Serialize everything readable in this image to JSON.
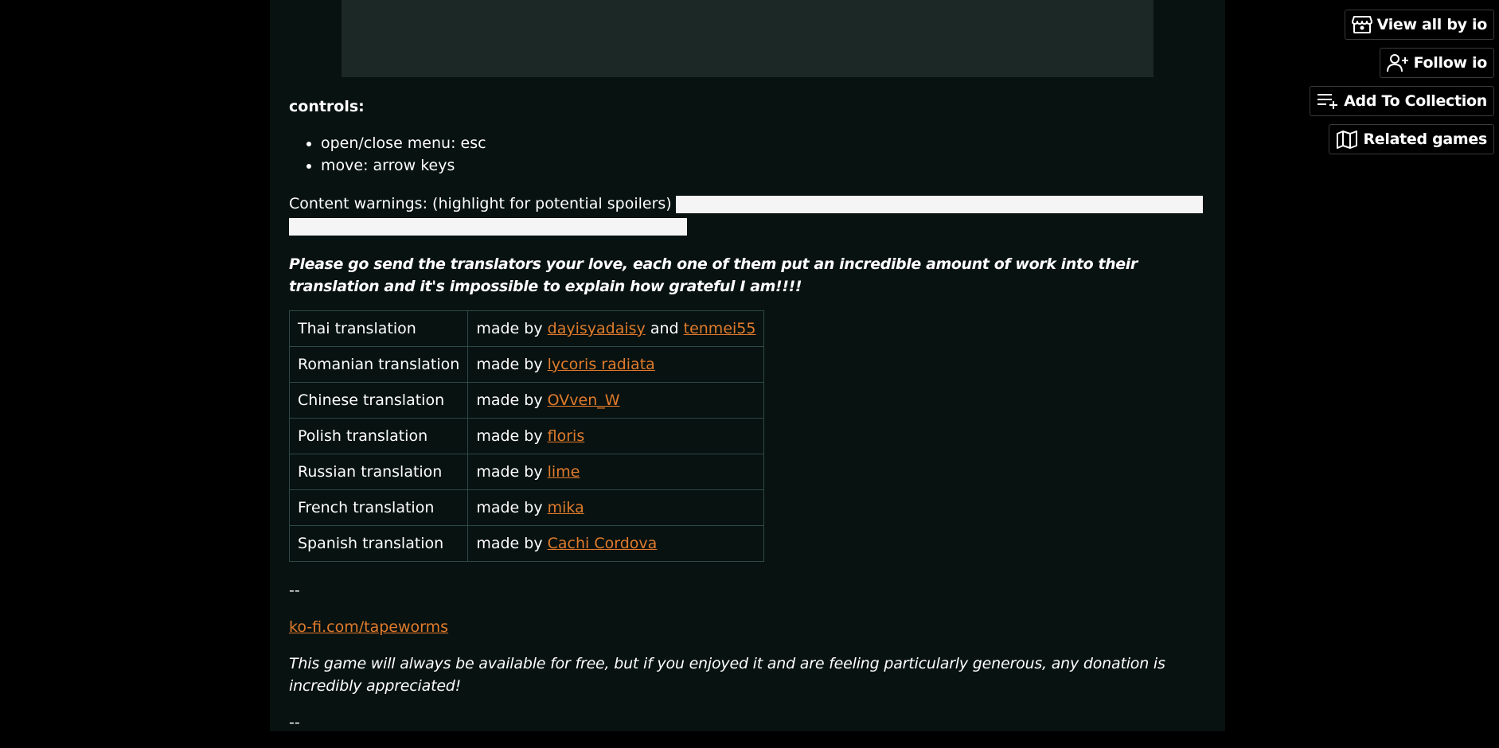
{
  "controls": {
    "heading": "controls:",
    "items": [
      "open/close menu: esc",
      "move: arrow keys"
    ]
  },
  "content_warnings": {
    "label": "Content warnings: (highlight for potential spoilers)"
  },
  "love_note": "Please go send the translators your love, each one of them put an incredible amount of work into their translation and it's impossible to explain how grateful I am!!!!",
  "translations": [
    {
      "language": "Thai translation",
      "made_by": "made by",
      "translators": [
        "dayisyadaisy",
        "tenmei55"
      ],
      "joiner": "and"
    },
    {
      "language": "Romanian translation",
      "made_by": "made by",
      "translators": [
        "lycoris radiata"
      ]
    },
    {
      "language": "Chinese translation",
      "made_by": "made by",
      "translators": [
        "OVven_W"
      ]
    },
    {
      "language": "Polish translation",
      "made_by": "made by",
      "translators": [
        "floris"
      ]
    },
    {
      "language": "Russian translation",
      "made_by": "made by",
      "translators": [
        "lime"
      ]
    },
    {
      "language": "French translation",
      "made_by": "made by",
      "translators": [
        "mika"
      ]
    },
    {
      "language": "Spanish translation",
      "made_by": "made by",
      "translators": [
        "Cachi Cordova"
      ]
    }
  ],
  "separator": "--",
  "kofi_link": "ko-fi.com/tapeworms",
  "donation_note": "This game will always be available for free, but if you enjoyed it and are feeling particularly generous, any donation is incredibly appreciated!",
  "separator_bottom": "--",
  "side_actions": {
    "view_all": "View all by io",
    "follow": "Follow io",
    "add_collection": "Add To Collection",
    "related": "Related games"
  },
  "colors": {
    "link": "#e07b2c",
    "column_bg": "#081210",
    "embed_bg": "#1c2826",
    "table_border": "#2d4a44"
  },
  "icons": {
    "view_all": "itchio-store-icon",
    "follow": "user-plus-icon",
    "add_collection": "playlist-add-icon",
    "related": "map-icon"
  }
}
